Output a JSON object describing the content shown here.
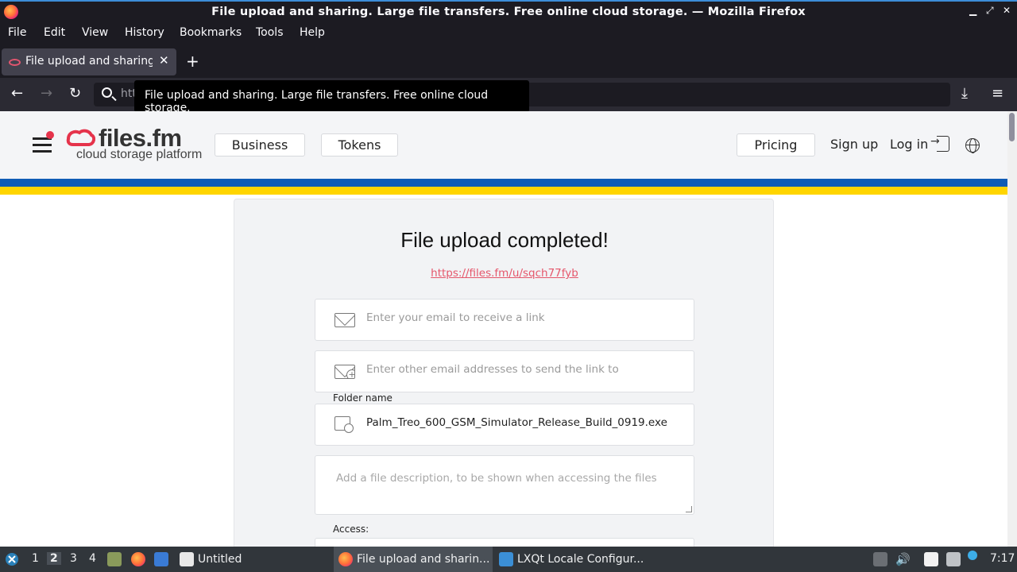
{
  "window": {
    "title": "File upload and sharing. Large file transfers. Free online cloud storage. — Mozilla Firefox",
    "min": "▁",
    "max": "⤢",
    "close": "✕"
  },
  "menu": [
    "File",
    "Edit",
    "View",
    "History",
    "Bookmarks",
    "Tools",
    "Help"
  ],
  "tab": {
    "label": "File upload and sharing. Large",
    "close": "✕",
    "new": "+"
  },
  "nav": {
    "back": "←",
    "forward": "→",
    "reload": "↻",
    "url_partial": "htt",
    "download": "⤓",
    "menu": "≡",
    "tooltip": "File upload and sharing. Large file transfers. Free online cloud storage."
  },
  "site": {
    "logo": "files.fm",
    "logo_sub": "cloud storage platform",
    "business": "Business",
    "tokens": "Tokens",
    "pricing": "Pricing",
    "signup": "Sign up",
    "login": "Log in"
  },
  "card": {
    "heading": "File upload completed!",
    "link": "https://files.fm/u/sqch77fyb",
    "email_placeholder": "Enter your email to receive a link",
    "other_email_placeholder": "Enter other email addresses to send the link to",
    "folder_label": "Folder name",
    "folder_value": "Palm_Treo_600_GSM_Simulator_Release_Build_0919.exe",
    "description_placeholder": "Add a file description, to be shown when accessing the files",
    "access_label": "Access:"
  },
  "taskbar": {
    "desktops": [
      "1",
      "2",
      "3",
      "4"
    ],
    "active_desktop": "2",
    "tasks": [
      {
        "label": "Untitled"
      },
      {
        "label": "File upload and sharin..."
      },
      {
        "label": "LXQt Locale Configur..."
      }
    ],
    "clock": "7:17"
  },
  "colors": {
    "accent_link": "#e5566b",
    "stripe_blue": "#0f5cb5",
    "stripe_yellow": "#ffd500"
  }
}
